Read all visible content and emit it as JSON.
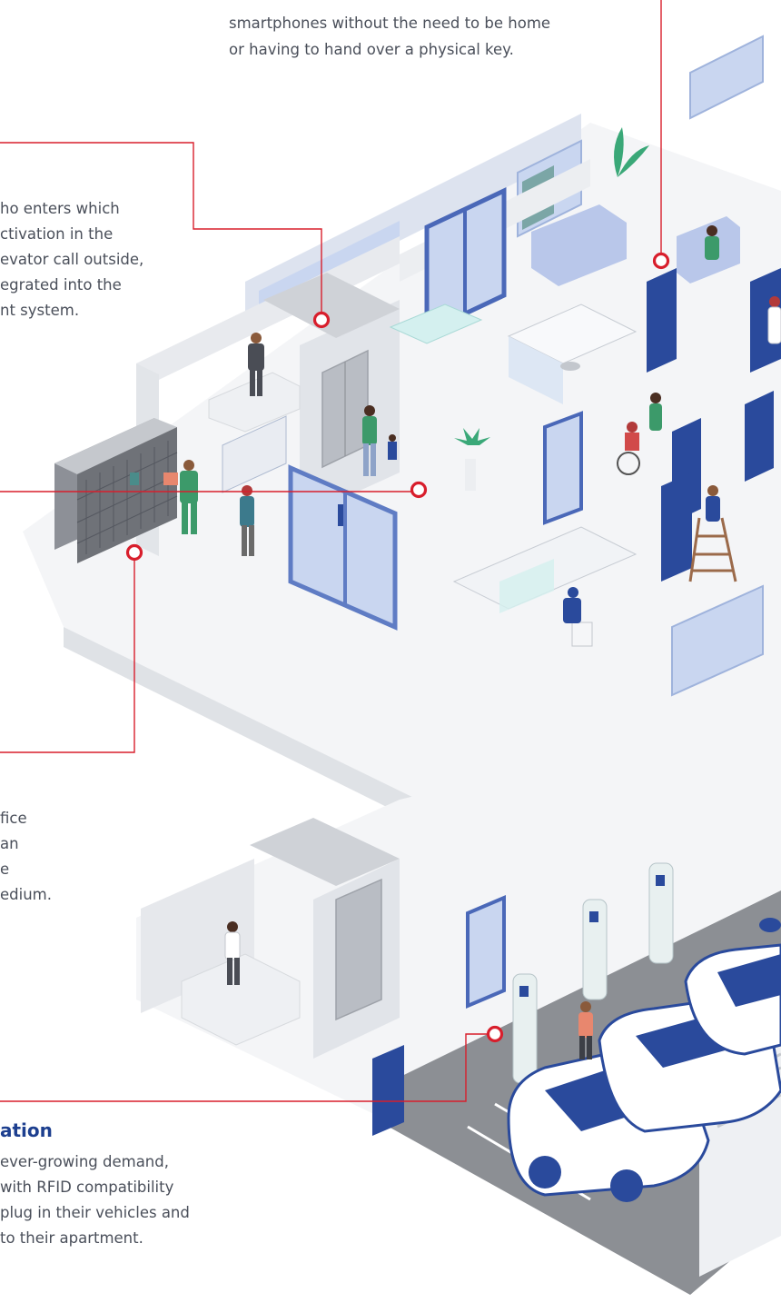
{
  "callouts": {
    "smart_lock": {
      "lines": [
        "smartphones without the need to be home",
        "or having to hand over a physical key."
      ]
    },
    "access_control": {
      "lines": [
        "ho enters which",
        "ctivation in the",
        "evator call outside,",
        "egrated into the",
        "nt system."
      ]
    },
    "parcel": {
      "lines": [
        "fice",
        "an",
        "e",
        "edium."
      ]
    },
    "ev_charging": {
      "heading": "ation",
      "lines": [
        "ever-growing demand,",
        "with RFID compatibility",
        "plug in their vehicles and",
        "to their apartment."
      ]
    }
  },
  "colors": {
    "accent_red": "#d81e2c",
    "door_blue": "#2a4a9c",
    "heading_blue": "#1d3f8f",
    "glass": "#c9d6f0",
    "floor": "#f3f4f6",
    "wall": "#e4e6ea",
    "road": "#8c8f94"
  }
}
